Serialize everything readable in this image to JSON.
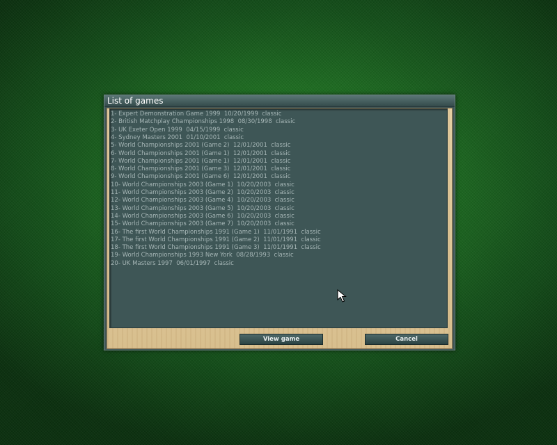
{
  "dialog": {
    "title": "List of games",
    "view_button": "View game",
    "cancel_button": "Cancel",
    "games": [
      "1- Expert Demonstration Game 1999  10/20/1999  classic",
      "2- British Matchplay Championships 1998  08/30/1998  classic",
      "3- UK Exeter Open 1999  04/15/1999  classic",
      "4- Sydney Masters 2001  01/10/2001  classic",
      "5- World Championships 2001 (Game 2)  12/01/2001  classic",
      "6- World Championships 2001 (Game 1)  12/01/2001  classic",
      "7- World Championships 2001 (Game 1)  12/01/2001  classic",
      "8- World Championships 2001 (Game 3)  12/01/2001  classic",
      "9- World Championships 2001 (Game 6)  12/01/2001  classic",
      "10- World Championships 2003 (Game 1)  10/20/2003  classic",
      "11- World Championships 2003 (Game 2)  10/20/2003  classic",
      "12- World Championships 2003 (Game 4)  10/20/2003  classic",
      "13- World Championships 2003 (Game 5)  10/20/2003  classic",
      "14- World Championships 2003 (Game 6)  10/20/2003  classic",
      "15- World Championships 2003 (Game 7)  10/20/2003  classic",
      "16- The first World Championships 1991 (Game 1)  11/01/1991  classic",
      "17- The first World Championships 1991 (Game 2)  11/01/1991  classic",
      "18- The first World Championships 1991 (Game 3)  11/01/1991  classic",
      "19- World Championships 1993 New York  08/28/1993  classic",
      "20- UK Masters 1997  06/01/1997  classic"
    ]
  },
  "colors": {
    "felt": "#1f6e22",
    "panel": "#3e5656",
    "wood": "#dcc596",
    "text": "#a6b6b6"
  },
  "icons": {
    "cursor": "arrow-cursor-icon"
  }
}
